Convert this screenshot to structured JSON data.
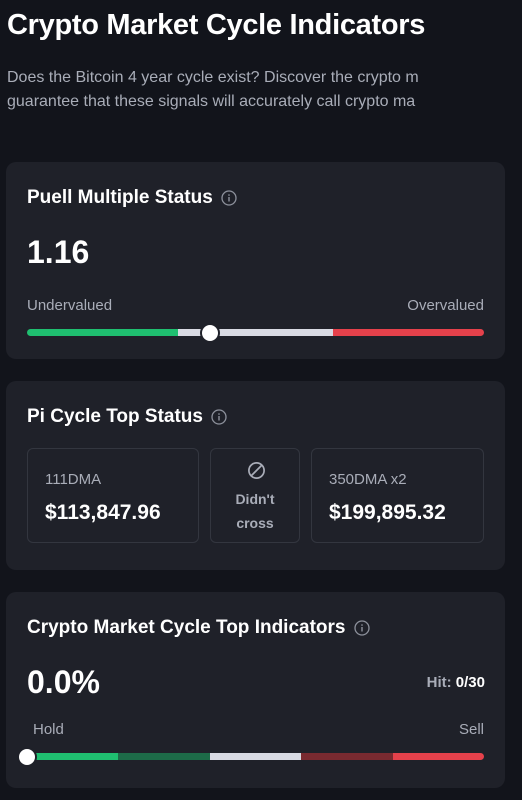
{
  "header": {
    "title": "Crypto Market Cycle Indicators",
    "description_line1": "Does the Bitcoin 4 year cycle exist? Discover the crypto m",
    "description_line2": "guarantee that these signals will accurately call crypto ma"
  },
  "puell": {
    "title": "Puell Multiple Status",
    "value": "1.16",
    "low_label": "Undervalued",
    "high_label": "Overvalued",
    "indicator_position_fraction": 0.4
  },
  "pi_cycle": {
    "title": "Pi Cycle Top Status",
    "left": {
      "label": "111DMA",
      "value": "$113,847.96"
    },
    "middle": {
      "line1": "Didn't",
      "line2": "cross"
    },
    "right": {
      "label": "350DMA x2",
      "value": "$199,895.32"
    }
  },
  "top_indicators": {
    "title": "Crypto Market Cycle Top Indicators",
    "value": "0.0%",
    "hit_label": "Hit:",
    "hit_value": "0/30",
    "low_label": "Hold",
    "high_label": "Sell",
    "indicator_position_fraction": 0.0
  },
  "colors": {
    "background": "#12141b",
    "card": "#1f2129",
    "green": "#1fbf70",
    "dark_green": "#1d6b48",
    "neutral": "#d8dae3",
    "dark_red": "#7a2a30",
    "red": "#e5414b"
  }
}
